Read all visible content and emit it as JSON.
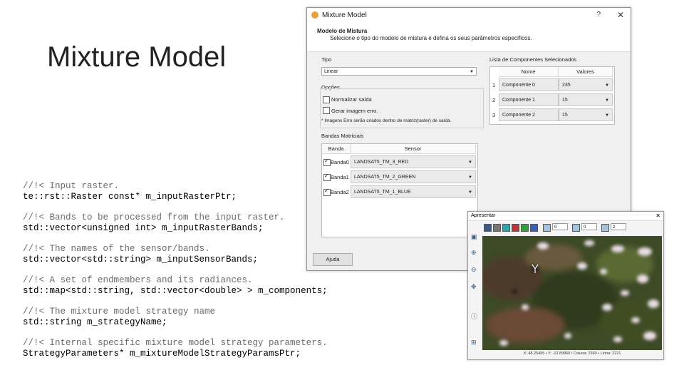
{
  "slide": {
    "title": "Mixture Model",
    "code_blocks": [
      {
        "comment": "//!< Input raster.",
        "code": "te::rst::Raster const* m_inputRasterPtr;"
      },
      {
        "comment": "//!< Bands to be processed from the input raster.",
        "code": "std::vector<unsigned int> m_inputRasterBands;"
      },
      {
        "comment": "//!< The names of the sensor/bands.",
        "code": "std::vector<std::string> m_inputSensorBands;"
      },
      {
        "comment": "//!< A set of endmembers and its radiances.",
        "code": "std::map<std::string, std::vector<double> > m_components;"
      },
      {
        "comment": "//!< The mixture model strategy name",
        "code": "std::string m_strategyName;"
      },
      {
        "comment": "//!< Internal specific mixture model strategy parameters.",
        "code": "StrategyParameters* m_mixtureModelStrategyParamsPtr;"
      }
    ]
  },
  "dialog": {
    "title": "Mixture Model",
    "help": "?",
    "close": "✕",
    "header_title": "Modelo de Mistura",
    "header_subtitle": "Selecione o tipo do modelo de mistura e defina os seus parâmetros específicos.",
    "tipo_label": "Tipo",
    "tipo_value": "Linear",
    "opcoes_label": "Opções",
    "opt_normalize": "Normalizar saída",
    "opt_error": "Gerar imagem erro.",
    "note": "* Imagens Erro serão criados dentro de matriz(raster) de saída.",
    "bandas_label": "Bandas Matriciais",
    "bandas_headers": [
      "Banda",
      "Sensor"
    ],
    "bandas_rows": [
      {
        "band": "Banda0",
        "sensor": "LANDSAT5_TM_3_RED"
      },
      {
        "band": "Banda1",
        "sensor": "LANDSAT5_TM_2_GREEN"
      },
      {
        "band": "Banda2",
        "sensor": "LANDSAT5_TM_1_BLUE"
      }
    ],
    "comp_label": "Lista de Componentes Selecionados",
    "comp_headers": [
      "Nome",
      "Valores"
    ],
    "comp_rows": [
      {
        "num": "1",
        "name": "Componente 0",
        "value": "235"
      },
      {
        "num": "2",
        "name": "Componente 1",
        "value": "15"
      },
      {
        "num": "3",
        "name": "Componente 2",
        "value": "15"
      }
    ],
    "help_button": "Ajuda"
  },
  "viewer": {
    "title": "Apresentar",
    "close": "✕",
    "band_selectors": [
      "0",
      "0",
      "2"
    ],
    "status": "X: 48.25495 • Y: -12.69960 / Coluna: 2390 • Linha: 2221"
  },
  "colors": {
    "dialog_bg": "#f0f0f0",
    "title_orange": "#e8a13a"
  }
}
